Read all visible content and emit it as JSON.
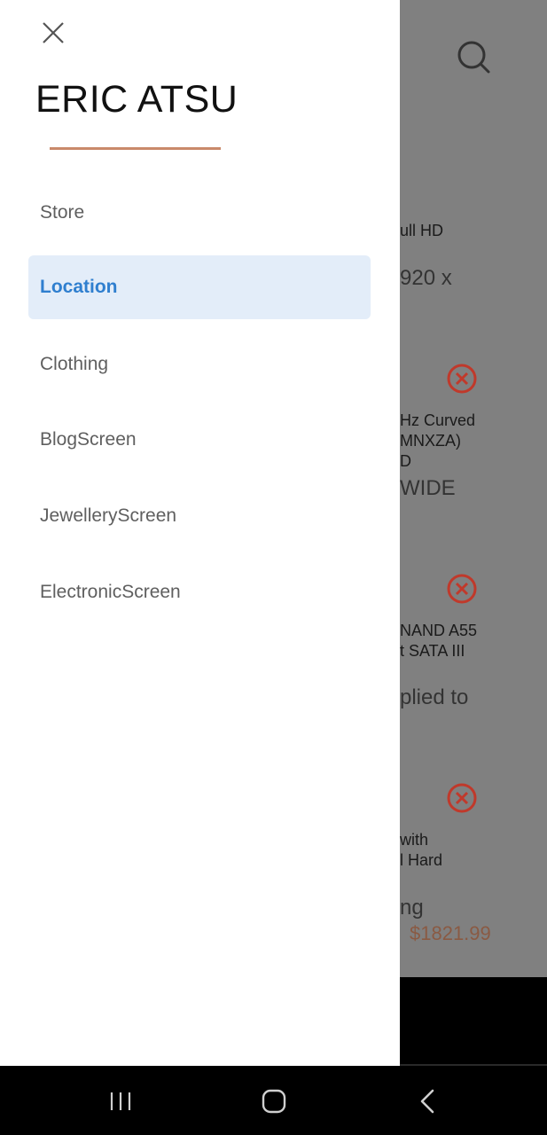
{
  "drawer": {
    "user_name": "ERIC ATSU",
    "close_icon": "close-icon",
    "menu_items": [
      {
        "label": "Store",
        "active": false
      },
      {
        "label": "Location",
        "active": true
      },
      {
        "label": "Clothing",
        "active": false
      },
      {
        "label": "BlogScreen",
        "active": false
      },
      {
        "label": "JewelleryScreen",
        "active": false
      },
      {
        "label": "ElectronicScreen",
        "active": false
      }
    ],
    "accent_color": "#c9896a",
    "active_color": "#2f7fcf"
  },
  "background": {
    "search_icon": "search-icon",
    "snippets": [
      "ull HD",
      "920 x",
      "Hz Curved\nMNXZA)\nD",
      "WIDE",
      "NAND A55\nt SATA III",
      "plied to",
      "with\nl Hard",
      "ng"
    ],
    "price": "$1821.99",
    "price_color": "#8a5a43",
    "remove_icon_color": "#c0392b"
  },
  "system_nav": {
    "recents_icon": "recents-icon",
    "home_icon": "home-icon",
    "back_icon": "back-icon"
  }
}
